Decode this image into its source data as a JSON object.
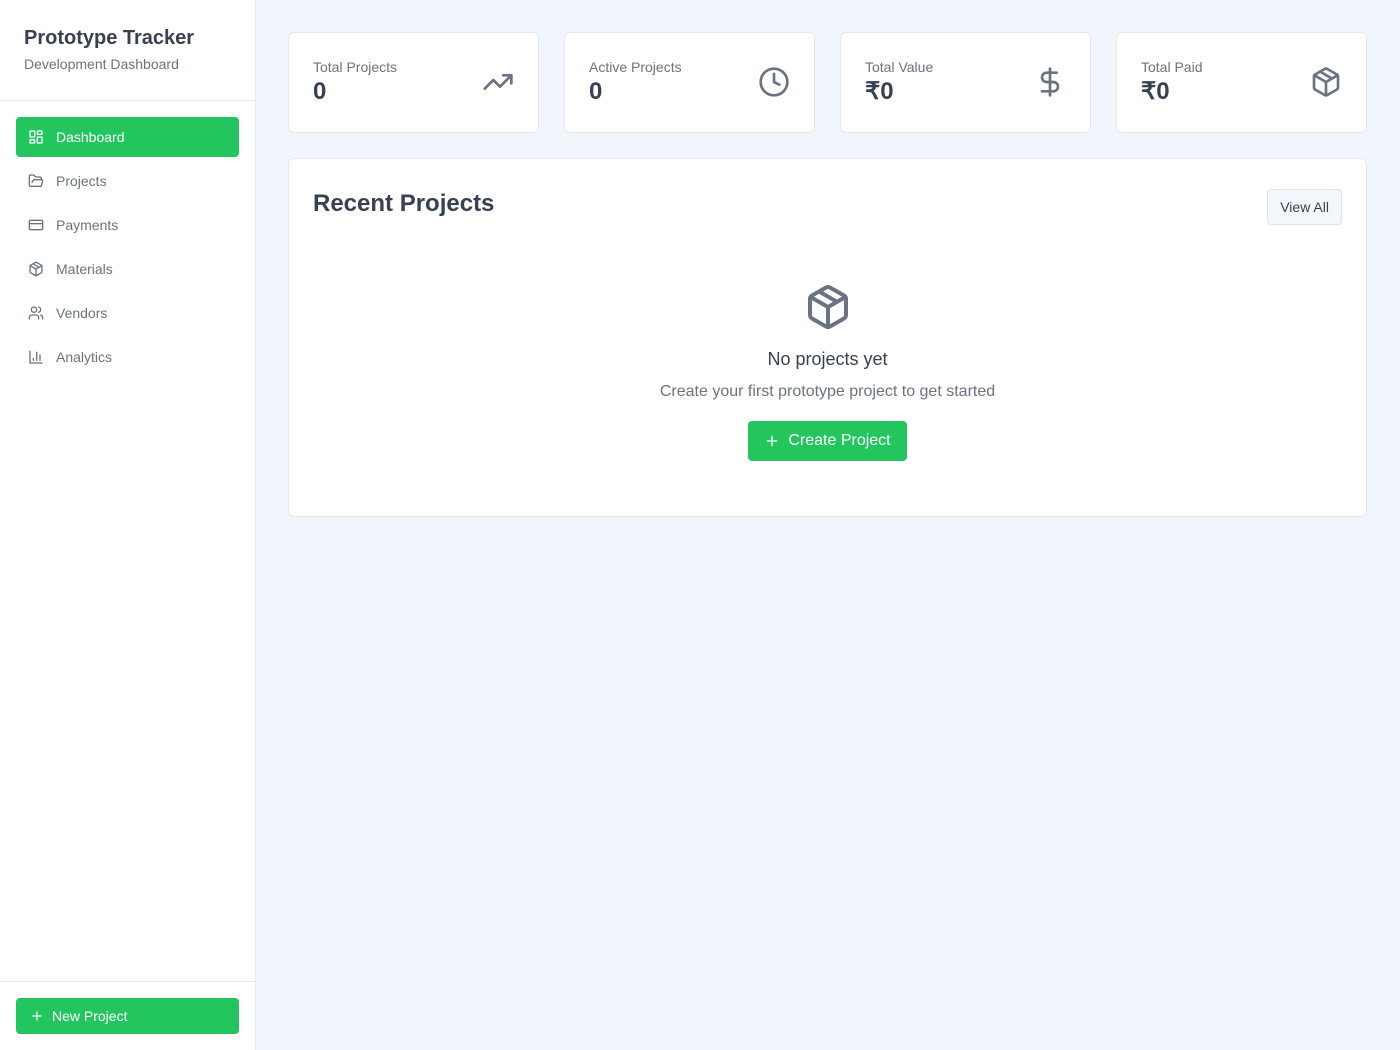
{
  "sidebar": {
    "title": "Prototype Tracker",
    "subtitle": "Development Dashboard",
    "items": [
      {
        "label": "Dashboard",
        "icon": "layout-dashboard-icon",
        "active": true
      },
      {
        "label": "Projects",
        "icon": "folder-open-icon"
      },
      {
        "label": "Payments",
        "icon": "credit-card-icon"
      },
      {
        "label": "Materials",
        "icon": "package-icon"
      },
      {
        "label": "Vendors",
        "icon": "users-icon"
      },
      {
        "label": "Analytics",
        "icon": "bar-chart-icon"
      }
    ],
    "new_project_label": "New Project"
  },
  "stats": [
    {
      "label": "Total Projects",
      "value": "0",
      "icon": "trending-up-icon"
    },
    {
      "label": "Active Projects",
      "value": "0",
      "icon": "clock-icon"
    },
    {
      "label": "Total Value",
      "value": "₹0",
      "icon": "dollar-sign-icon"
    },
    {
      "label": "Total Paid",
      "value": "₹0",
      "icon": "package-icon"
    }
  ],
  "recent": {
    "title": "Recent Projects",
    "view_all_label": "View All",
    "empty_title": "No projects yet",
    "empty_text": "Create your first prototype project to get started",
    "create_label": "Create Project"
  },
  "colors": {
    "accent": "#22c55e",
    "background": "#f0f6fc",
    "text": "#374151",
    "muted": "#6b7280"
  }
}
